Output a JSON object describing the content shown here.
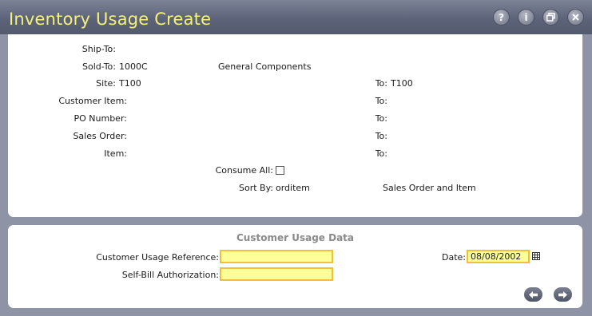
{
  "window": {
    "title": "Inventory Usage Create",
    "buttons": {
      "help": "?",
      "info": "i"
    }
  },
  "header_panel": {
    "ship_to_label": "Ship-To:",
    "sold_to_label": "Sold-To:",
    "sold_to_value": "1000C",
    "sold_to_name": "General Components",
    "site_label": "Site:",
    "site_value": "T100",
    "site_to_label": "To:",
    "site_to_value": "T100",
    "customer_item_label": "Customer Item:",
    "customer_item_to_label": "To:",
    "po_number_label": "PO Number:",
    "po_number_to_label": "To:",
    "sales_order_label": "Sales Order:",
    "sales_order_to_label": "To:",
    "item_label": "Item:",
    "item_to_label": "To:",
    "consume_all_label": "Consume All:",
    "consume_all_checked": false,
    "sort_by_label": "Sort By:",
    "sort_by_value": "orditem",
    "sort_by_description": "Sales Order and Item"
  },
  "usage_panel": {
    "title": "Customer Usage Data",
    "reference_label": "Customer Usage Reference:",
    "reference_value": "",
    "self_bill_label": "Self-Bill Authorization:",
    "self_bill_value": "",
    "date_label": "Date:",
    "date_value": "08/08/2002"
  },
  "icons": {
    "help": "help-icon",
    "info": "info-icon",
    "restore": "restore-window-icon",
    "close": "close-icon",
    "calendar": "calendar-icon",
    "back": "back-arrow-icon",
    "forward": "forward-arrow-icon"
  },
  "colors": {
    "title_text": "#f2f27a",
    "field_background": "#ffff99",
    "field_border": "#f0c03a",
    "frame": "#8e94a6"
  }
}
